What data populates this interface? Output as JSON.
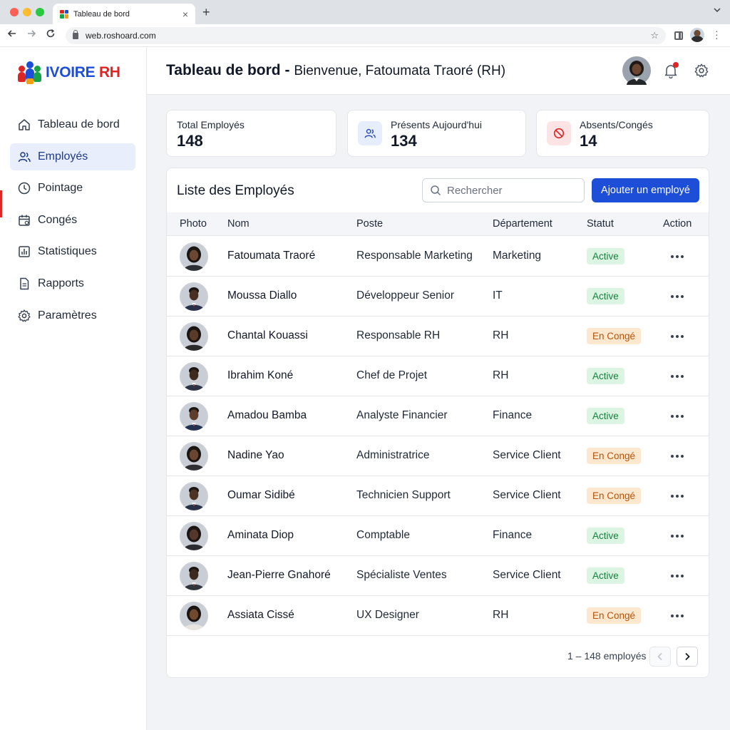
{
  "browser": {
    "tab_title": "Tableau de bord",
    "url": "web.roshoard.com"
  },
  "brand": {
    "part1": "IVOIRE",
    "part2": "RH",
    "colors": {
      "blue": "#1d4ed8",
      "red": "#dc2626",
      "green": "#16a34a",
      "orange": "#f59e0b"
    }
  },
  "sidebar": {
    "items": [
      {
        "label": "Tableau de bord",
        "icon": "home-icon",
        "active": false
      },
      {
        "label": "Employés",
        "icon": "users-icon",
        "active": true
      },
      {
        "label": "Pointage",
        "icon": "clock-icon",
        "active": false
      },
      {
        "label": "Congés",
        "icon": "calendar-icon",
        "active": false
      },
      {
        "label": "Statistiques",
        "icon": "chart-icon",
        "active": false
      },
      {
        "label": "Rapports",
        "icon": "document-icon",
        "active": false
      },
      {
        "label": "Paramètres",
        "icon": "gear-icon",
        "active": false
      }
    ]
  },
  "header": {
    "title": "Tableau de bord -",
    "subtitle": "Bienvenue, Fatoumata Traoré (RH)"
  },
  "stats": [
    {
      "label": "Total Employés",
      "value": "148"
    },
    {
      "label": "Présents Aujourd'hui",
      "value": "134",
      "icon": "users-icon"
    },
    {
      "label": "Absents/Congés",
      "value": "14",
      "icon": "block-icon"
    }
  ],
  "employees": {
    "title": "Liste des Employés",
    "search_placeholder": "Rechercher",
    "add_button": "Ajouter un employé",
    "columns": [
      "Photo",
      "Nom",
      "Poste",
      "Département",
      "Statut",
      "Action"
    ],
    "rows": [
      {
        "name": "Fatoumata Traoré",
        "role": "Responsable Marketing",
        "dept": "Marketing",
        "status": "Active"
      },
      {
        "name": "Moussa Diallo",
        "role": "Développeur Senior",
        "dept": "IT",
        "status": "Active"
      },
      {
        "name": "Chantal Kouassi",
        "role": "Responsable RH",
        "dept": "RH",
        "status": "En Congé"
      },
      {
        "name": "Ibrahim Koné",
        "role": "Chef de Projet",
        "dept": "RH",
        "status": "Active"
      },
      {
        "name": "Amadou Bamba",
        "role": "Analyste Financier",
        "dept": "Finance",
        "status": "Active"
      },
      {
        "name": "Nadine Yao",
        "role": "Administratrice",
        "dept": "Service Client",
        "status": "En Congé"
      },
      {
        "name": "Oumar Sidibé",
        "role": "Technicien Support",
        "dept": "Service Client",
        "status": "En Congé"
      },
      {
        "name": "Aminata Diop",
        "role": "Comptable",
        "dept": "Finance",
        "status": "Active"
      },
      {
        "name": "Jean-Pierre Gnahoré",
        "role": "Spécialiste Ventes",
        "dept": "Service Client",
        "status": "Active"
      },
      {
        "name": "Assiata Cissé",
        "role": "UX Designer",
        "dept": "RH",
        "status": "En Congé"
      }
    ],
    "pagination": "1 – 148 employés"
  }
}
